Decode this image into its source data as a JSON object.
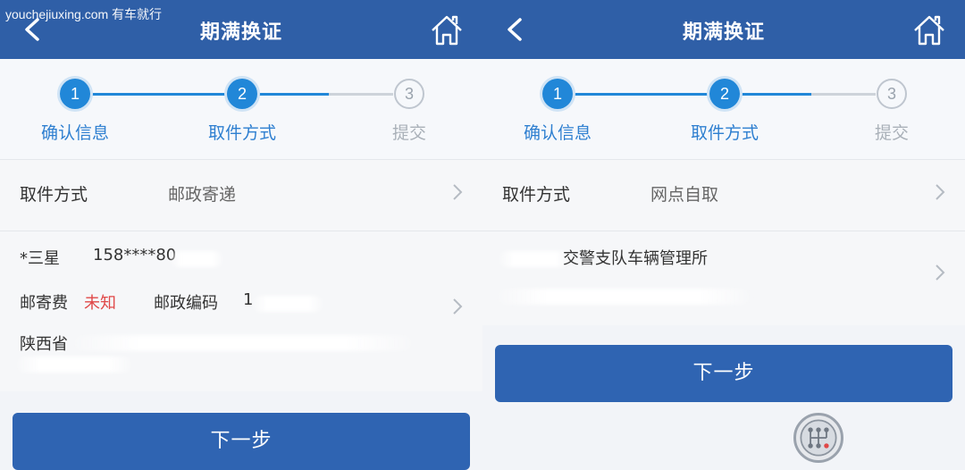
{
  "watermark": "youchejiuxing.com 有车就行",
  "left": {
    "title": "期满换证",
    "steps": [
      {
        "num": "1",
        "label": "确认信息"
      },
      {
        "num": "2",
        "label": "取件方式"
      },
      {
        "num": "3",
        "label": "提交"
      }
    ],
    "pickup": {
      "label": "取件方式",
      "value": "邮政寄递"
    },
    "contact": {
      "name": "*三星",
      "phone": "158****80"
    },
    "postage": {
      "label": "邮寄费",
      "value": "未知",
      "zip_label": "邮政编码",
      "zip_value": "1"
    },
    "address_prefix": "陕西省",
    "next_button": "下一步"
  },
  "right": {
    "title": "期满换证",
    "steps": [
      {
        "num": "1",
        "label": "确认信息"
      },
      {
        "num": "2",
        "label": "取件方式"
      },
      {
        "num": "3",
        "label": "提交"
      }
    ],
    "pickup": {
      "label": "取件方式",
      "value": "网点自取"
    },
    "office_name": "交警支队车辆管理所",
    "next_button": "下一步"
  },
  "colors": {
    "header": "#2f5fa7",
    "step_active": "#2187d8",
    "button": "#2f64b2",
    "highlight": "#e04848"
  }
}
